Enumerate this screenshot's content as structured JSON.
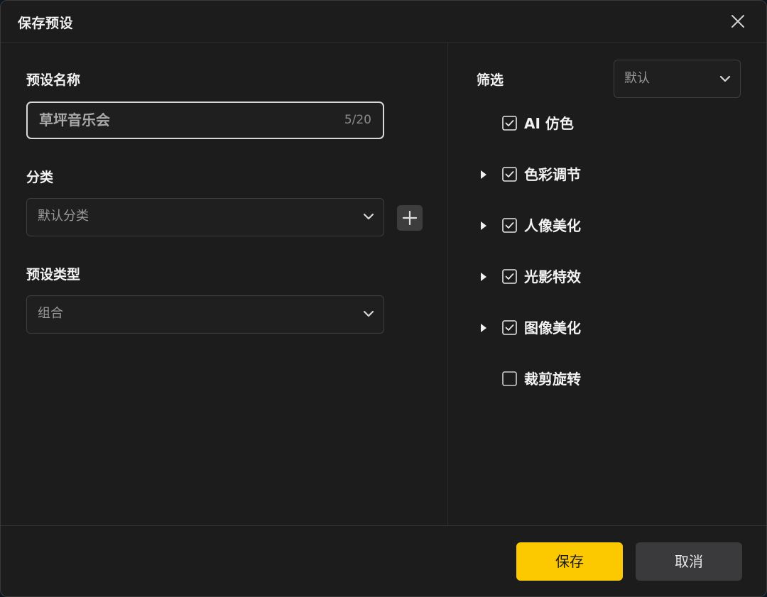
{
  "dialog": {
    "title": "保存预设",
    "close_icon": "close-icon"
  },
  "left": {
    "preset_name": {
      "label": "预设名称",
      "value": "草坪音乐会",
      "counter": "5/20"
    },
    "category": {
      "label": "分类",
      "selected": "默认分类",
      "add_icon": "plus-icon"
    },
    "preset_type": {
      "label": "预设类型",
      "selected": "组合"
    }
  },
  "right": {
    "filter": {
      "label": "筛选",
      "selected": "默认"
    },
    "items": [
      {
        "label": "AI 仿色",
        "checked": true,
        "expandable": false
      },
      {
        "label": "色彩调节",
        "checked": true,
        "expandable": true
      },
      {
        "label": "人像美化",
        "checked": true,
        "expandable": true
      },
      {
        "label": "光影特效",
        "checked": true,
        "expandable": true
      },
      {
        "label": "图像美化",
        "checked": true,
        "expandable": true
      },
      {
        "label": "裁剪旋转",
        "checked": false,
        "expandable": false
      }
    ]
  },
  "footer": {
    "save_label": "保存",
    "cancel_label": "取消"
  },
  "colors": {
    "accent": "#fcc800",
    "background": "#1c1c1c",
    "border": "#3e3e3e"
  }
}
